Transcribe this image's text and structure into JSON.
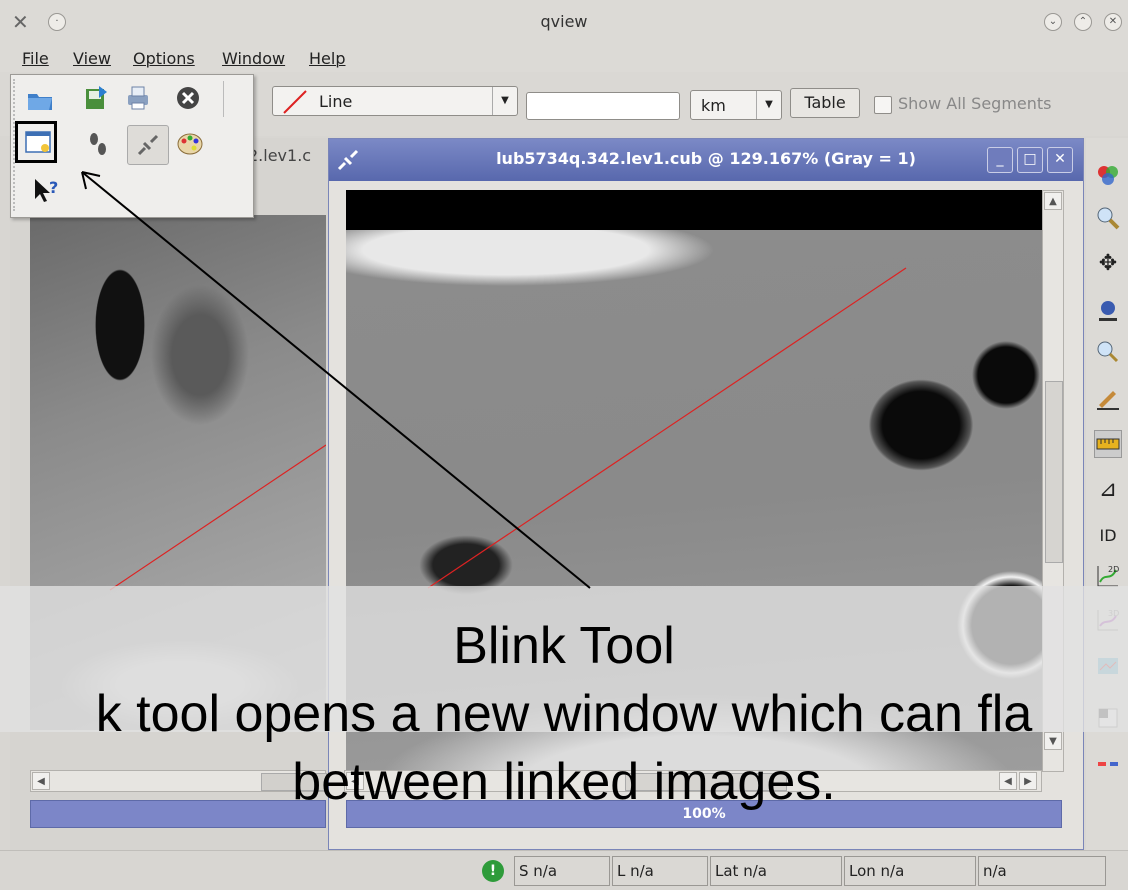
{
  "window": {
    "title": "qview"
  },
  "menu": [
    "File",
    "View",
    "Options",
    "Window",
    "Help"
  ],
  "toolbar": {
    "line_type": "Line",
    "length_value": "",
    "units": "km",
    "table_label": "Table",
    "show_all_segments": "Show All Segments",
    "show_all_checked": false
  },
  "popup_icons": [
    "open-file-icon",
    "export-icon",
    "print-icon",
    "close-circle-icon",
    "blink-tool-icon",
    "footprint-icon",
    "link-icon",
    "palette-icon",
    "whats-this-icon"
  ],
  "left_window": {
    "title_fragment": "2.lev1.c"
  },
  "sub_window": {
    "title": "lub5734q.342.lev1.cub @ 129.167% (Gray = 1)",
    "progress": "100%",
    "progress_fraction": 1.0
  },
  "right_palette": [
    "band-icon",
    "zoom-icon",
    "pan-icon",
    "stretch-icon",
    "find-icon",
    "edit-icon",
    "measure-icon",
    "histogram-icon",
    "ID",
    "plot-2d-icon",
    "plot-3d-icon",
    "spectral-icon",
    "scatter-icon"
  ],
  "status": {
    "sample": "S n/a",
    "line": "L n/a",
    "lat": "Lat n/a",
    "lon": "Lon n/a",
    "dn": "n/a"
  },
  "annotation": {
    "title": "Blink Tool",
    "body_line1": "k tool opens a new window which can fla",
    "body_line2": "between linked images."
  },
  "colors": {
    "accent": "#6a77b8",
    "measure_line": "#d22"
  }
}
